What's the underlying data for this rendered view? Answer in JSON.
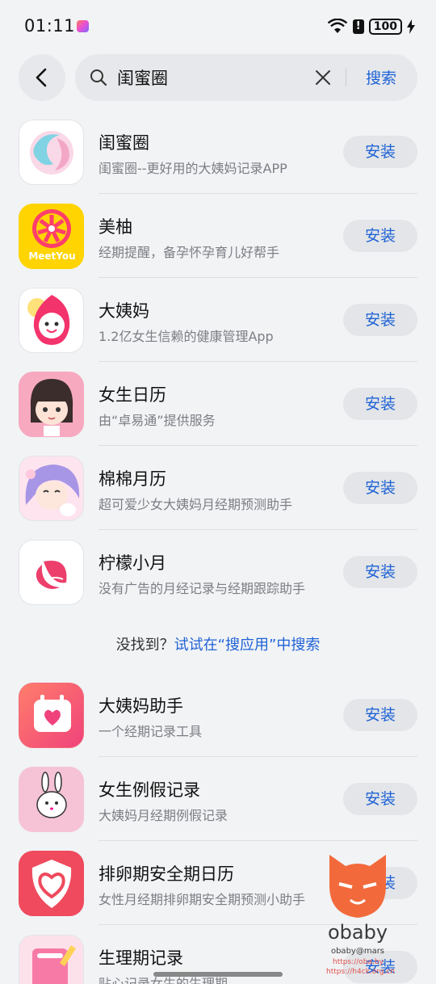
{
  "status": {
    "time": "01:11",
    "battery": "100"
  },
  "search": {
    "value": "闺蜜圈",
    "button": "搜索"
  },
  "results": [
    {
      "name": "闺蜜圈",
      "desc": "闺蜜圈--更好用的大姨妈记录APP",
      "action": "安装"
    },
    {
      "name": "美柚",
      "desc": "经期提醒，备孕怀孕育儿好帮手",
      "action": "安装",
      "icon_text": "MeetYou"
    },
    {
      "name": "大姨妈",
      "desc": "1.2亿女生信赖的健康管理App",
      "action": "安装"
    },
    {
      "name": "女生日历",
      "desc": "由“卓易通”提供服务",
      "action": "安装"
    },
    {
      "name": "棉棉月历",
      "desc": "超可爱少女大姨妈月经期预测助手",
      "action": "安装"
    },
    {
      "name": "柠檬小月",
      "desc": "没有广告的月经记录与经期跟踪助手",
      "action": "安装"
    }
  ],
  "not_found": {
    "prefix": "没找到？",
    "link": "试试在“搜应用”中搜索"
  },
  "more_results": [
    {
      "name": "大姨妈助手",
      "desc": "一个经期记录工具",
      "action": "安装"
    },
    {
      "name": "女生例假记录",
      "desc": "大姨妈月经期例假记录",
      "action": "安装"
    },
    {
      "name": "排卵期安全期日历",
      "desc": "女性月经期排卵期安全期预测小助手",
      "action": "安装"
    },
    {
      "name": "生理期记录",
      "desc": "贴心记录女生的生理期",
      "action": "安装"
    }
  ],
  "watermark": {
    "brand": "obaby",
    "handle": "obaby@mars",
    "url1": "https://oba.by",
    "url2": "https://h4ck.org.cn"
  }
}
